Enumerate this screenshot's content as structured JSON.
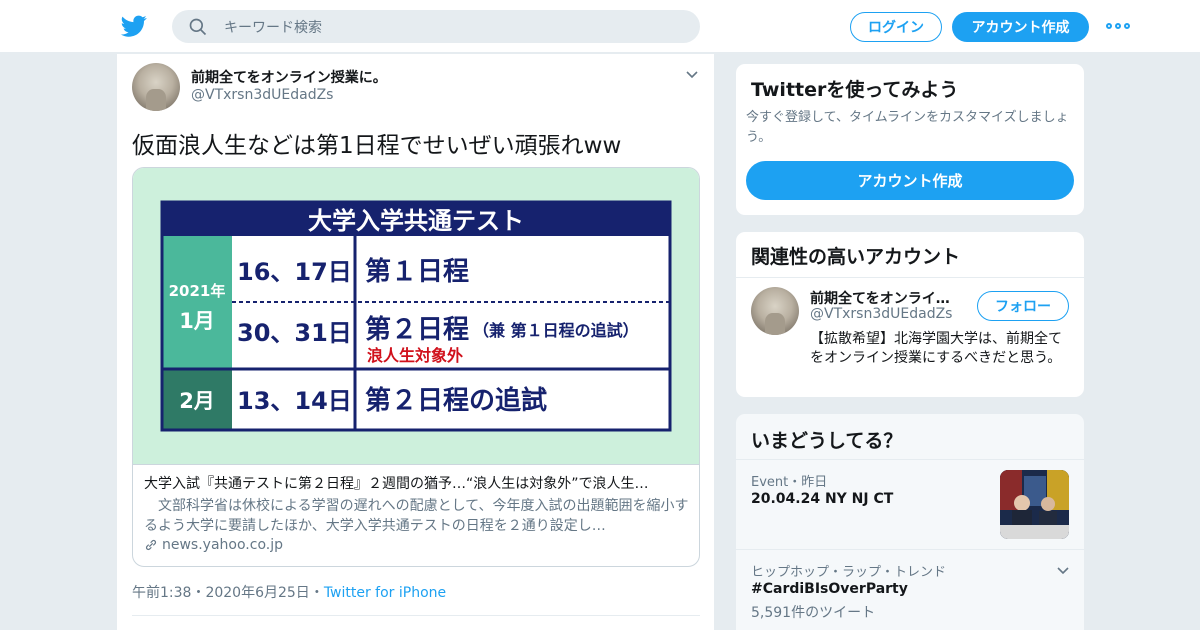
{
  "header": {
    "logo_icon": "twitter-bird-icon",
    "search_placeholder": "キーワード検索",
    "login_label": "ログイン",
    "signup_label": "アカウント作成",
    "more_icon": "more-dots-icon",
    "accent_color": "#1da1f2"
  },
  "tweet": {
    "author_name": "前期全てをオンライン授業に。",
    "author_handle": "@VTxrsn3dUEdadZs",
    "text": "仮面浪人生などは第1日程でせいぜい頑張れww",
    "card": {
      "image": {
        "banner": "大学入学共通テスト",
        "row_2021_year": "2021年",
        "row_2021_month": "1月",
        "date1": "16、17日",
        "label1": "第１日程",
        "date2": "30、31日",
        "label2_main": "第２日程",
        "label2_sub": "（兼 第１日程の追試）",
        "label2_note": "浪人生対象外",
        "month2": "2月",
        "date3": "13、14日",
        "label3": "第２日程の追試"
      },
      "title": "大学入試『共通テストに第２日程』２週間の猶予…“浪人生は対象外”で浪人生…",
      "description": "　文部科学省は休校による学習の遅れへの配慮として、今年度入試の出題範囲を縮小するよう大学に要請したほか、大学入学共通テストの日程を２通り設定し…",
      "url": "news.yahoo.co.jp"
    },
    "time": "午前1:38",
    "date": "2020年6月25日",
    "source": "Twitter for iPhone",
    "separator": "・"
  },
  "sidebar": {
    "try_twitter": {
      "heading": "Twitterを使ってみよう",
      "sub": "今すぐ登録して、タイムラインをカスタマイズしましょう。",
      "cta": "アカウント作成"
    },
    "related": {
      "heading": "関連性の高いアカウント",
      "name": "前期全てをオンライ…",
      "handle": "@VTxrsn3dUEdadZs",
      "follow": "フォロー",
      "bio": "【拡散希望】北海学園大学は、前期全てをオンライン授業にするべきだと思う。"
    },
    "trends": {
      "heading": "いまどうしてる？",
      "event_meta": "Event・昨日",
      "event_title": "20.04.24 NY NJ CT",
      "trend_meta": "ヒップホップ・ラップ・トレンド",
      "trend_title": "#CardiBIsOverParty",
      "trend_count": "5,591件のツイート"
    }
  }
}
